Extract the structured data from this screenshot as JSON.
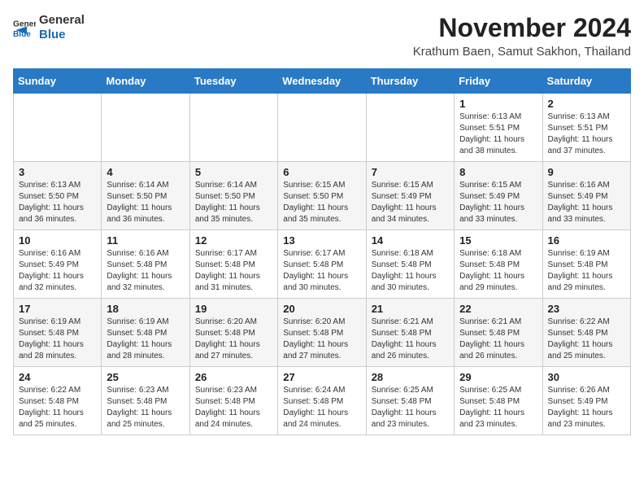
{
  "logo": {
    "general": "General",
    "blue": "Blue"
  },
  "title": "November 2024",
  "location": "Krathum Baen, Samut Sakhon, Thailand",
  "weekdays": [
    "Sunday",
    "Monday",
    "Tuesday",
    "Wednesday",
    "Thursday",
    "Friday",
    "Saturday"
  ],
  "weeks": [
    [
      {
        "day": "",
        "info": ""
      },
      {
        "day": "",
        "info": ""
      },
      {
        "day": "",
        "info": ""
      },
      {
        "day": "",
        "info": ""
      },
      {
        "day": "",
        "info": ""
      },
      {
        "day": "1",
        "info": "Sunrise: 6:13 AM\nSunset: 5:51 PM\nDaylight: 11 hours and 38 minutes."
      },
      {
        "day": "2",
        "info": "Sunrise: 6:13 AM\nSunset: 5:51 PM\nDaylight: 11 hours and 37 minutes."
      }
    ],
    [
      {
        "day": "3",
        "info": "Sunrise: 6:13 AM\nSunset: 5:50 PM\nDaylight: 11 hours and 36 minutes."
      },
      {
        "day": "4",
        "info": "Sunrise: 6:14 AM\nSunset: 5:50 PM\nDaylight: 11 hours and 36 minutes."
      },
      {
        "day": "5",
        "info": "Sunrise: 6:14 AM\nSunset: 5:50 PM\nDaylight: 11 hours and 35 minutes."
      },
      {
        "day": "6",
        "info": "Sunrise: 6:15 AM\nSunset: 5:50 PM\nDaylight: 11 hours and 35 minutes."
      },
      {
        "day": "7",
        "info": "Sunrise: 6:15 AM\nSunset: 5:49 PM\nDaylight: 11 hours and 34 minutes."
      },
      {
        "day": "8",
        "info": "Sunrise: 6:15 AM\nSunset: 5:49 PM\nDaylight: 11 hours and 33 minutes."
      },
      {
        "day": "9",
        "info": "Sunrise: 6:16 AM\nSunset: 5:49 PM\nDaylight: 11 hours and 33 minutes."
      }
    ],
    [
      {
        "day": "10",
        "info": "Sunrise: 6:16 AM\nSunset: 5:49 PM\nDaylight: 11 hours and 32 minutes."
      },
      {
        "day": "11",
        "info": "Sunrise: 6:16 AM\nSunset: 5:48 PM\nDaylight: 11 hours and 32 minutes."
      },
      {
        "day": "12",
        "info": "Sunrise: 6:17 AM\nSunset: 5:48 PM\nDaylight: 11 hours and 31 minutes."
      },
      {
        "day": "13",
        "info": "Sunrise: 6:17 AM\nSunset: 5:48 PM\nDaylight: 11 hours and 30 minutes."
      },
      {
        "day": "14",
        "info": "Sunrise: 6:18 AM\nSunset: 5:48 PM\nDaylight: 11 hours and 30 minutes."
      },
      {
        "day": "15",
        "info": "Sunrise: 6:18 AM\nSunset: 5:48 PM\nDaylight: 11 hours and 29 minutes."
      },
      {
        "day": "16",
        "info": "Sunrise: 6:19 AM\nSunset: 5:48 PM\nDaylight: 11 hours and 29 minutes."
      }
    ],
    [
      {
        "day": "17",
        "info": "Sunrise: 6:19 AM\nSunset: 5:48 PM\nDaylight: 11 hours and 28 minutes."
      },
      {
        "day": "18",
        "info": "Sunrise: 6:19 AM\nSunset: 5:48 PM\nDaylight: 11 hours and 28 minutes."
      },
      {
        "day": "19",
        "info": "Sunrise: 6:20 AM\nSunset: 5:48 PM\nDaylight: 11 hours and 27 minutes."
      },
      {
        "day": "20",
        "info": "Sunrise: 6:20 AM\nSunset: 5:48 PM\nDaylight: 11 hours and 27 minutes."
      },
      {
        "day": "21",
        "info": "Sunrise: 6:21 AM\nSunset: 5:48 PM\nDaylight: 11 hours and 26 minutes."
      },
      {
        "day": "22",
        "info": "Sunrise: 6:21 AM\nSunset: 5:48 PM\nDaylight: 11 hours and 26 minutes."
      },
      {
        "day": "23",
        "info": "Sunrise: 6:22 AM\nSunset: 5:48 PM\nDaylight: 11 hours and 25 minutes."
      }
    ],
    [
      {
        "day": "24",
        "info": "Sunrise: 6:22 AM\nSunset: 5:48 PM\nDaylight: 11 hours and 25 minutes."
      },
      {
        "day": "25",
        "info": "Sunrise: 6:23 AM\nSunset: 5:48 PM\nDaylight: 11 hours and 25 minutes."
      },
      {
        "day": "26",
        "info": "Sunrise: 6:23 AM\nSunset: 5:48 PM\nDaylight: 11 hours and 24 minutes."
      },
      {
        "day": "27",
        "info": "Sunrise: 6:24 AM\nSunset: 5:48 PM\nDaylight: 11 hours and 24 minutes."
      },
      {
        "day": "28",
        "info": "Sunrise: 6:25 AM\nSunset: 5:48 PM\nDaylight: 11 hours and 23 minutes."
      },
      {
        "day": "29",
        "info": "Sunrise: 6:25 AM\nSunset: 5:48 PM\nDaylight: 11 hours and 23 minutes."
      },
      {
        "day": "30",
        "info": "Sunrise: 6:26 AM\nSunset: 5:49 PM\nDaylight: 11 hours and 23 minutes."
      }
    ]
  ]
}
